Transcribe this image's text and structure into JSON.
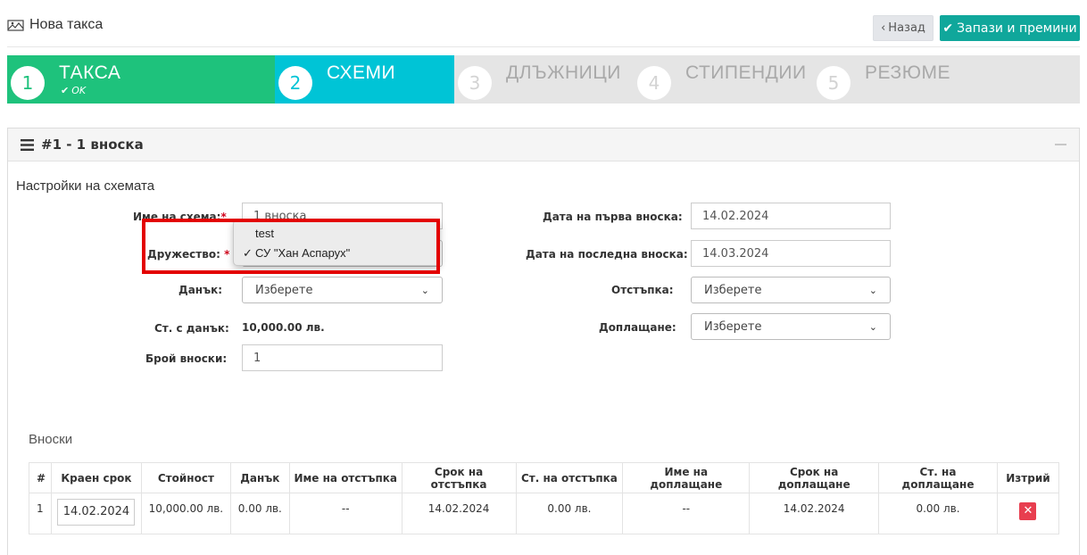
{
  "header": {
    "title": "Нова такса",
    "back_label": "Назад",
    "save_label": "Запази и премини"
  },
  "wizard": {
    "steps": [
      {
        "number": "1",
        "label": "ТАКСА",
        "status": "OK"
      },
      {
        "number": "2",
        "label": "СХЕМИ"
      },
      {
        "number": "3",
        "label": "ДЛЪЖНИЦИ"
      },
      {
        "number": "4",
        "label": "СТИПЕНДИИ"
      },
      {
        "number": "5",
        "label": "РЕЗЮМЕ"
      }
    ]
  },
  "panel": {
    "title": "#1 - 1 вноска",
    "section_title": "Настройки на схемата"
  },
  "form": {
    "scheme_name_label": "Име на схема:",
    "scheme_name_value": "1 вноска",
    "company_label": "Дружество:",
    "tax_label": "Данък:",
    "tax_value": "Изберете",
    "price_with_tax_label": "Ст. с данък:",
    "price_with_tax_value": "10,000.00 лв.",
    "installments_label": "Брой вноски:",
    "installments_value": "1",
    "first_date_label": "Дата на първа вноска:",
    "first_date_value": "14.02.2024",
    "last_date_label": "Дата на последна вноска:",
    "last_date_value": "14.03.2024",
    "discount_label": "Отстъпка:",
    "discount_value": "Изберете",
    "surcharge_label": "Доплащане:",
    "surcharge_value": "Изберете",
    "required_mark": "*"
  },
  "dropdown": {
    "options": [
      "test",
      "СУ \"Хан Аспарух\""
    ],
    "selected": "СУ \"Хан Аспарух\"",
    "check": "✓"
  },
  "installments": {
    "title": "Вноски",
    "columns": [
      "#",
      "Краен срок",
      "Стойност",
      "Данък",
      "Име на отстъпка",
      "Срок на отстъпка",
      "Ст. на отстъпка",
      "Име на доплащане",
      "Срок на доплащане",
      "Ст. на доплащане",
      "Изтрий"
    ],
    "rows": [
      {
        "num": "1",
        "deadline": "14.02.2024",
        "value": "10,000.00 лв.",
        "tax": "0.00 лв.",
        "discount_name": "--",
        "discount_date": "14.02.2024",
        "discount_value": "0.00 лв.",
        "surcharge_name": "--",
        "surcharge_date": "14.02.2024",
        "surcharge_value": "0.00 лв.",
        "delete_label": "✕"
      }
    ]
  },
  "colors": {
    "step_done": "#1ec27c",
    "step_active": "#00c4d6",
    "save_button": "#10a79b",
    "highlight": "#e30000",
    "delete": "#e83e4f"
  }
}
